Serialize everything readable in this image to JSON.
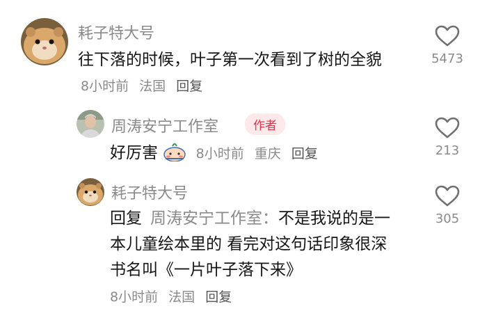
{
  "comments": [
    {
      "username": "耗子特大号",
      "text": "往下落的时候，叶子第一次看到了树的全貌",
      "time": "8小时前",
      "location": "法国",
      "reply_label": "回复",
      "likes": "5473",
      "avatar": "hamster-avatar"
    },
    {
      "username": "周涛安宁工作室",
      "badge": "作者",
      "text": "好厉害",
      "emoji": "blushing-sticker-emoji",
      "time": "8小时前",
      "location": "重庆",
      "reply_label": "回复",
      "likes": "213",
      "avatar": "man-avatar"
    },
    {
      "username": "耗子特大号",
      "reply_prefix": "回复",
      "reply_to": "周涛安宁工作室：",
      "text": "不是我说的是一本儿童绘本里的 看完对这句话印象很深 书名叫《一片叶子落下来》",
      "time": "8小时前",
      "location": "法国",
      "reply_label": "回复",
      "likes": "305",
      "avatar": "hamster-avatar"
    }
  ],
  "colors": {
    "username": "#8a8a8a",
    "text": "#161616",
    "badge_bg": "#fde8ea",
    "badge_text": "#e0334d",
    "heart_outline": "#6f6f6f"
  }
}
